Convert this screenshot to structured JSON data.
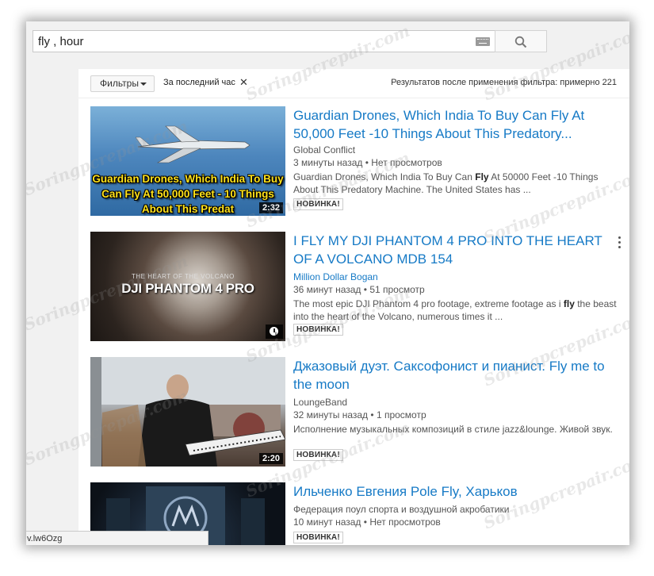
{
  "search": {
    "query": "fly , hour"
  },
  "filter_bar": {
    "filters_label": "Фильтры",
    "active_filter": "За последний час",
    "results_count": "Результатов после применения фильтра: примерно 221"
  },
  "results": [
    {
      "title": "Guardian Drones, Which India To Buy Can Fly At 50,000 Feet -10 Things About This Predatory...",
      "channel": "Global Conflict",
      "time": "3 минуты назад",
      "views": "Нет просмотров",
      "desc_before": "Guardian Drones, Which India To Buy Can ",
      "desc_bold": "Fly",
      "desc_after": " At 50000 Feet -10 Things About This Predatory Machine. The United States has ...",
      "badge": "НОВИНКА!",
      "duration": "2:32",
      "thumb_caption": "Guardian Drones, Which India To Buy Can Fly At 50,000 Feet - 10 Things About This Predat"
    },
    {
      "title": "I FLY MY DJI PHANTOM 4 PRO INTO THE HEART OF A VOLCANO MDB 154",
      "channel": "Million Dollar Bogan",
      "time": "36 минут назад",
      "views": "51 просмотр",
      "desc_before": "The most epic DJI Phantom 4 pro footage, extreme footage as i ",
      "desc_bold": "fly",
      "desc_after": " the beast into the heart of the Volcano, numerous times it ...",
      "badge": "НОВИНКА!",
      "thumb_caption": "DJI PHANTOM 4 PRO",
      "thumb_subcaption": "THE HEART OF THE VOLCANO"
    },
    {
      "title": "Джазовый дуэт. Саксофонист и пианист. Fly me to the moon",
      "channel": "LoungeBand",
      "time": "32 минуты назад",
      "views": "1 просмотр",
      "desc_before": "Исполнение музыкальных композиций в стиле jazz&lounge. Живой звук.",
      "desc_bold": "",
      "desc_after": "",
      "badge": "НОВИНКА!",
      "duration": "2:20"
    },
    {
      "title": "Ильченко Евгения Pole Fly, Харьков",
      "channel": "Федерация поул спорта и воздушной акробатики",
      "time": "10 минут назад",
      "views": "Нет просмотров",
      "badge": "НОВИНКА!"
    }
  ],
  "status_bar": {
    "url_fragment": "v.lw6Ozg"
  },
  "watermark": "Soringpcrepair.com",
  "colors": {
    "link": "#167ac6",
    "text_secondary": "#555555"
  }
}
